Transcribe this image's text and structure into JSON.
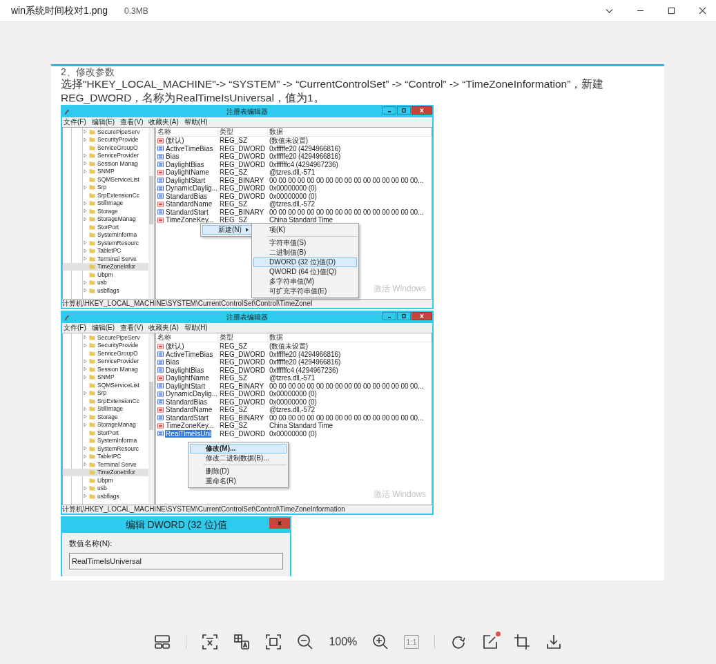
{
  "viewer": {
    "file_name": "win系统时间校对1.png",
    "file_size": "0.3MB"
  },
  "document": {
    "heading": "2、修改参数",
    "paragraph": "选择\"HKEY_LOCAL_MACHINE\"-> “SYSTEM” -> “CurrentControlSet” -> “Control” -> “TimeZoneInformation”，新建REG_DWORD，名称为RealTimeIsUniversal，值为1。"
  },
  "regedit_windows": [
    {
      "title": "注册表编辑器",
      "menu": [
        "文件(F)",
        "编辑(E)",
        "查看(V)",
        "收藏夹(A)",
        "帮助(H)"
      ],
      "tree": [
        {
          "label": "SecurePipeServ",
          "expandable": true,
          "selected": false
        },
        {
          "label": "SecurityProvide",
          "expandable": true,
          "selected": false
        },
        {
          "label": "ServiceGroupO",
          "expandable": false,
          "selected": false
        },
        {
          "label": "ServiceProvider",
          "expandable": true,
          "selected": false
        },
        {
          "label": "Session Manag",
          "expandable": true,
          "selected": false
        },
        {
          "label": "SNMP",
          "expandable": true,
          "selected": false
        },
        {
          "label": "SQMServiceList",
          "expandable": false,
          "selected": false
        },
        {
          "label": "Srp",
          "expandable": true,
          "selected": false
        },
        {
          "label": "SrpExtensionCc",
          "expandable": false,
          "selected": false
        },
        {
          "label": "StillImage",
          "expandable": true,
          "selected": false
        },
        {
          "label": "Storage",
          "expandable": true,
          "selected": false
        },
        {
          "label": "StorageManag",
          "expandable": true,
          "selected": false
        },
        {
          "label": "StorPort",
          "expandable": false,
          "selected": false
        },
        {
          "label": "SystemInforma",
          "expandable": false,
          "selected": false
        },
        {
          "label": "SystemResourc",
          "expandable": true,
          "selected": false
        },
        {
          "label": "TabletPC",
          "expandable": true,
          "selected": false
        },
        {
          "label": "Terminal Serve",
          "expandable": true,
          "selected": false
        },
        {
          "label": "TimeZoneInfor",
          "expandable": false,
          "selected": true
        },
        {
          "label": "Ubpm",
          "expandable": false,
          "selected": false
        },
        {
          "label": "usb",
          "expandable": true,
          "selected": false
        },
        {
          "label": "usbflags",
          "expandable": true,
          "selected": false
        }
      ],
      "columns": [
        "名称",
        "类型",
        "数据"
      ],
      "values": [
        {
          "kind": "sz",
          "name": "(默认)",
          "type": "REG_SZ",
          "data": "(数值未设置)",
          "selected": false
        },
        {
          "kind": "dword",
          "name": "ActiveTimeBias",
          "type": "REG_DWORD",
          "data": "0xfffffe20 (4294966816)",
          "selected": false
        },
        {
          "kind": "dword",
          "name": "Bias",
          "type": "REG_DWORD",
          "data": "0xfffffe20 (4294966816)",
          "selected": false
        },
        {
          "kind": "dword",
          "name": "DaylightBias",
          "type": "REG_DWORD",
          "data": "0xffffffc4 (4294967236)",
          "selected": false
        },
        {
          "kind": "sz",
          "name": "DaylightName",
          "type": "REG_SZ",
          "data": "@tzres.dll,-571",
          "selected": false
        },
        {
          "kind": "dword",
          "name": "DaylightStart",
          "type": "REG_BINARY",
          "data": "00 00 00 00 00 00 00 00 00 00 00 00 00 00 00 00...",
          "selected": false
        },
        {
          "kind": "dword",
          "name": "DynamicDaylig...",
          "type": "REG_DWORD",
          "data": "0x00000000 (0)",
          "selected": false
        },
        {
          "kind": "dword",
          "name": "StandardBias",
          "type": "REG_DWORD",
          "data": "0x00000000 (0)",
          "selected": false
        },
        {
          "kind": "sz",
          "name": "StandardName",
          "type": "REG_SZ",
          "data": "@tzres.dll,-572",
          "selected": false
        },
        {
          "kind": "dword",
          "name": "StandardStart",
          "type": "REG_BINARY",
          "data": "00 00 00 00 00 00 00 00 00 00 00 00 00 00 00 00...",
          "selected": false
        },
        {
          "kind": "sz",
          "name": "TimeZoneKey...",
          "type": "REG_SZ",
          "data": "China Standard Time",
          "selected": false
        }
      ],
      "context_menus": [
        {
          "items": [
            {
              "kind": "item",
              "label": "新建(N)",
              "has_submenu": true,
              "default": false,
              "selected": true
            }
          ]
        },
        {
          "items": [
            {
              "kind": "item",
              "label": "项(K)",
              "has_submenu": false,
              "default": false,
              "selected": false
            },
            {
              "kind": "separator"
            },
            {
              "kind": "item",
              "label": "字符串值(S)",
              "has_submenu": false,
              "default": false,
              "selected": false
            },
            {
              "kind": "item",
              "label": "二进制值(B)",
              "has_submenu": false,
              "default": false,
              "selected": false
            },
            {
              "kind": "item",
              "label": "DWORD (32 位)值(D)",
              "has_submenu": false,
              "default": false,
              "selected": true
            },
            {
              "kind": "item",
              "label": "QWORD (64 位)值(Q)",
              "has_submenu": false,
              "default": false,
              "selected": false
            },
            {
              "kind": "item",
              "label": "多字符串值(M)",
              "has_submenu": false,
              "default": false,
              "selected": false
            },
            {
              "kind": "item",
              "label": "可扩充字符串值(E)",
              "has_submenu": false,
              "default": false,
              "selected": false
            }
          ]
        }
      ],
      "activation_notice": "激活 Windows",
      "status_path": "计算机\\HKEY_LOCAL_MACHINE\\SYSTEM\\CurrentControlSet\\Control\\TimeZoneI"
    },
    {
      "title": "注册表编辑器",
      "menu": [
        "文件(F)",
        "编辑(E)",
        "查看(V)",
        "收藏夹(A)",
        "帮助(H)"
      ],
      "tree": [
        {
          "label": "SecurePipeServ",
          "expandable": true,
          "selected": false
        },
        {
          "label": "SecurityProvide",
          "expandable": true,
          "selected": false
        },
        {
          "label": "ServiceGroupO",
          "expandable": false,
          "selected": false
        },
        {
          "label": "ServiceProvider",
          "expandable": true,
          "selected": false
        },
        {
          "label": "Session Manag",
          "expandable": true,
          "selected": false
        },
        {
          "label": "SNMP",
          "expandable": true,
          "selected": false
        },
        {
          "label": "SQMServiceList",
          "expandable": false,
          "selected": false
        },
        {
          "label": "Srp",
          "expandable": true,
          "selected": false
        },
        {
          "label": "SrpExtensionCc",
          "expandable": false,
          "selected": false
        },
        {
          "label": "StillImage",
          "expandable": true,
          "selected": false
        },
        {
          "label": "Storage",
          "expandable": true,
          "selected": false
        },
        {
          "label": "StorageManag",
          "expandable": true,
          "selected": false
        },
        {
          "label": "StorPort",
          "expandable": false,
          "selected": false
        },
        {
          "label": "SystemInforma",
          "expandable": false,
          "selected": false
        },
        {
          "label": "SystemResourc",
          "expandable": true,
          "selected": false
        },
        {
          "label": "TabletPC",
          "expandable": true,
          "selected": false
        },
        {
          "label": "Terminal Serve",
          "expandable": true,
          "selected": false
        },
        {
          "label": "TimeZoneInfor",
          "expandable": false,
          "selected": true
        },
        {
          "label": "Ubpm",
          "expandable": false,
          "selected": false
        },
        {
          "label": "usb",
          "expandable": true,
          "selected": false
        },
        {
          "label": "usbflags",
          "expandable": true,
          "selected": false
        }
      ],
      "columns": [
        "名称",
        "类型",
        "数据"
      ],
      "values": [
        {
          "kind": "sz",
          "name": "(默认)",
          "type": "REG_SZ",
          "data": "(数值未设置)",
          "selected": false
        },
        {
          "kind": "dword",
          "name": "ActiveTimeBias",
          "type": "REG_DWORD",
          "data": "0xfffffe20 (4294966816)",
          "selected": false
        },
        {
          "kind": "dword",
          "name": "Bias",
          "type": "REG_DWORD",
          "data": "0xfffffe20 (4294966816)",
          "selected": false
        },
        {
          "kind": "dword",
          "name": "DaylightBias",
          "type": "REG_DWORD",
          "data": "0xffffffc4 (4294967236)",
          "selected": false
        },
        {
          "kind": "sz",
          "name": "DaylightName",
          "type": "REG_SZ",
          "data": "@tzres.dll,-571",
          "selected": false
        },
        {
          "kind": "dword",
          "name": "DaylightStart",
          "type": "REG_BINARY",
          "data": "00 00 00 00 00 00 00 00 00 00 00 00 00 00 00 00...",
          "selected": false
        },
        {
          "kind": "dword",
          "name": "DynamicDaylig...",
          "type": "REG_DWORD",
          "data": "0x00000000 (0)",
          "selected": false
        },
        {
          "kind": "dword",
          "name": "StandardBias",
          "type": "REG_DWORD",
          "data": "0x00000000 (0)",
          "selected": false
        },
        {
          "kind": "sz",
          "name": "StandardName",
          "type": "REG_SZ",
          "data": "@tzres.dll,-572",
          "selected": false
        },
        {
          "kind": "dword",
          "name": "StandardStart",
          "type": "REG_BINARY",
          "data": "00 00 00 00 00 00 00 00 00 00 00 00 00 00 00 00...",
          "selected": false
        },
        {
          "kind": "sz",
          "name": "TimeZoneKey...",
          "type": "REG_SZ",
          "data": "China Standard Time",
          "selected": false
        },
        {
          "kind": "dword",
          "name": "RealTimeIsUni",
          "type": "REG_DWORD",
          "data": "0x00000000 (0)",
          "selected": true
        }
      ],
      "context_menus": [
        {
          "items": [
            {
              "kind": "item",
              "label": "修改(M)...",
              "has_submenu": false,
              "default": true,
              "selected": true
            },
            {
              "kind": "item",
              "label": "修改二进制数据(B)...",
              "has_submenu": false,
              "default": false,
              "selected": false
            },
            {
              "kind": "separator"
            },
            {
              "kind": "item",
              "label": "删除(D)",
              "has_submenu": false,
              "default": false,
              "selected": false
            },
            {
              "kind": "item",
              "label": "重命名(R)",
              "has_submenu": false,
              "default": false,
              "selected": false
            }
          ]
        }
      ],
      "activation_notice": "激活 Windows",
      "status_path": "计算机\\HKEY_LOCAL_MACHINE\\SYSTEM\\CurrentControlSet\\Control\\TimeZoneInformation"
    }
  ],
  "dialog": {
    "title": "编辑 DWORD (32 位)值",
    "name_label": "数值名称(N):",
    "name_value": "RealTimeIsUniversal"
  },
  "toolbar": {
    "zoom": "100%",
    "actual_size": "1:1",
    "edit_notification": true
  }
}
